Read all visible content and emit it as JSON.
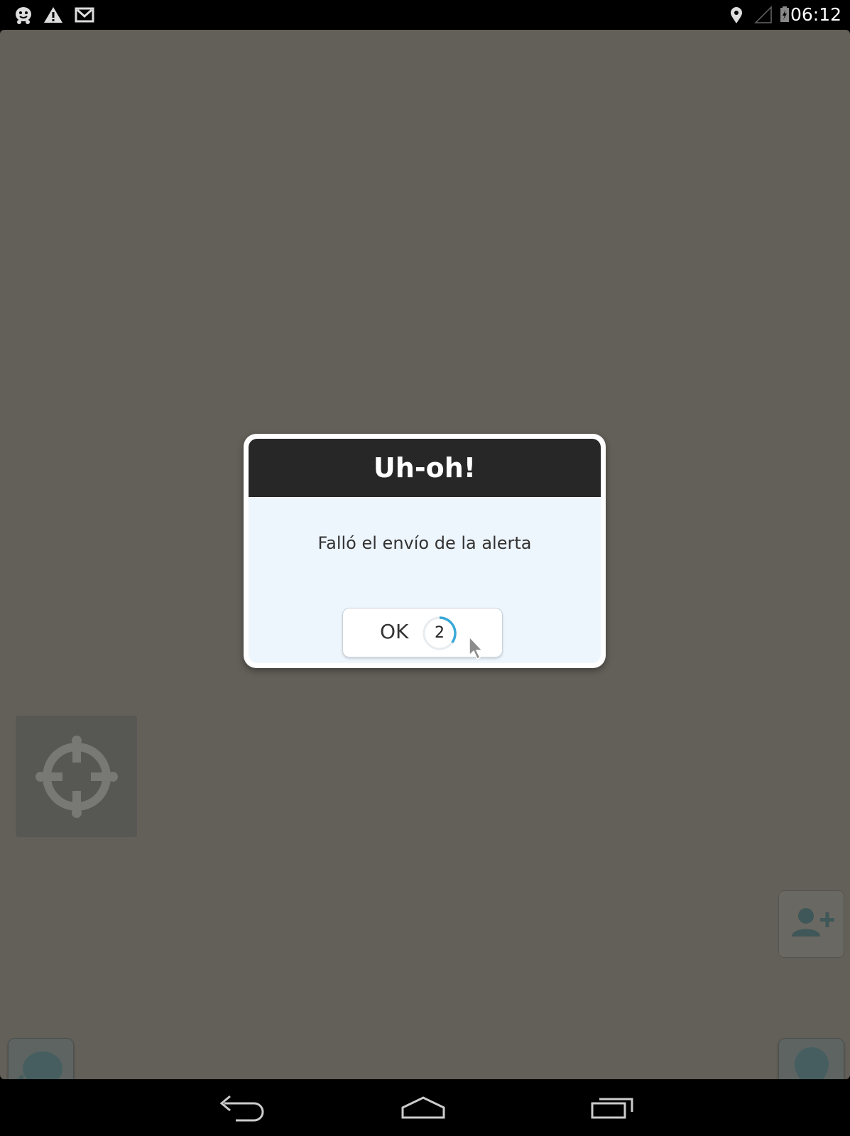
{
  "status_bar": {
    "time": "06:12",
    "icons_left": [
      "waze-icon",
      "warning-icon",
      "gmail-icon"
    ],
    "icons_right": [
      "location-icon",
      "signal-icon",
      "battery-icon"
    ]
  },
  "dialog": {
    "title": "Uh-oh!",
    "message": "Falló el envío de la alerta",
    "ok_label": "OK",
    "countdown": "2",
    "countdown_progress": 0.35
  },
  "colors": {
    "map_background": "#636059",
    "dialog_header": "#272727",
    "dialog_body": "#eef6fd",
    "countdown_accent": "#3aa8d8"
  },
  "overlay_buttons": {
    "locate": "crosshair-icon",
    "add_friend": "add-person-icon",
    "chat": "waze-chat-icon",
    "report": "report-pin-icon"
  },
  "nav_bar": {
    "buttons": [
      "back-icon",
      "home-icon",
      "recent-apps-icon"
    ]
  }
}
